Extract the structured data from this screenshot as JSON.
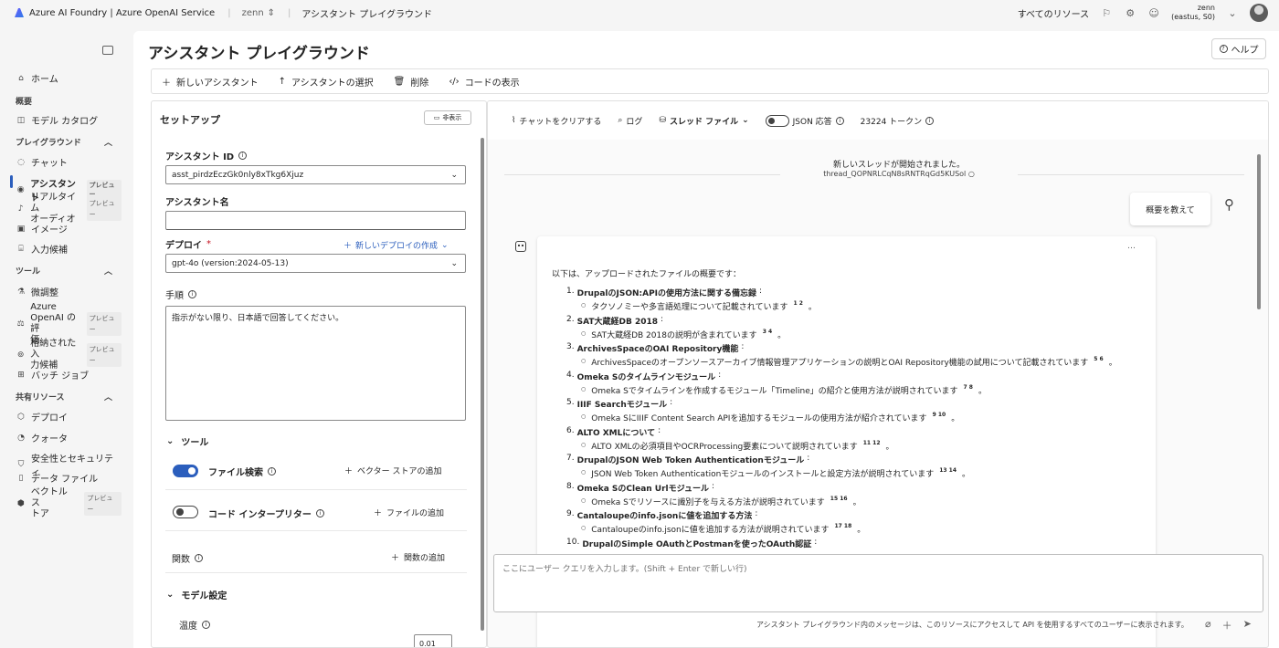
{
  "topbar": {
    "brand": "Azure AI Foundry | Azure OpenAI Service",
    "project": "zenn",
    "page": "アシスタント プレイグラウンド",
    "all_resources": "すべてのリソース",
    "user_name": "zenn",
    "user_region": "(eastus, S0)"
  },
  "sidebar": {
    "home": "ホーム",
    "overview_section": "概要",
    "model_catalog": "モデル カタログ",
    "playground_section": "プレイグラウンド",
    "chat": "チャット",
    "assistant": "アシスタント",
    "assistant_badge": "プレビュー",
    "realtime": "リアルタイム",
    "realtime2": "オーディオ",
    "realtime_badge": "プレビュー",
    "image": "イメージ",
    "completions": "入力候補",
    "tools_section": "ツール",
    "finetune": "微調整",
    "eval_1": "Azure",
    "eval_2": "OpenAI の評",
    "eval_3": "価",
    "eval_badge": "プレビュー",
    "stored_1": "格納された入",
    "stored_2": "力候補",
    "stored_badge": "プレビュー",
    "batch": "バッチ ジョブ",
    "shared_section": "共有リソース",
    "deploy": "デプロイ",
    "quota": "クォータ",
    "safety": "安全性とセキュリティ",
    "data_files": "データ ファイル",
    "vector_1": "ベクトル ス",
    "vector_2": "トア",
    "vector_badge": "プレビュー"
  },
  "main": {
    "title": "アシスタント プレイグラウンド",
    "help": "ヘルプ"
  },
  "toolbar": {
    "new_assistant": "新しいアシスタント",
    "select_assistant": "アシスタントの選択",
    "delete": "削除",
    "view_code": "コードの表示"
  },
  "setup": {
    "title": "セットアップ",
    "hide": "非表示",
    "assistant_id_label": "アシスタント ID",
    "assistant_id_value": "asst_pirdzEczGk0nly8xTkg6Xjuz",
    "assistant_name_label": "アシスタント名",
    "deploy_label": "デプロイ",
    "deploy_required": "*",
    "create_deploy": "新しいデプロイの作成",
    "deploy_value": "gpt-4o (version:2024-05-13)",
    "instructions_label": "手順",
    "instructions_value": "指示がない限り、日本語で回答してください。",
    "tools_head": "ツール",
    "file_search": "ファイル検索",
    "add_vector_store": "ベクター ストアの追加",
    "code_interpreter": "コード インタープリター",
    "add_file": "ファイルの追加",
    "functions": "関数",
    "add_function": "関数の追加",
    "model_settings": "モデル設定",
    "temperature": "温度",
    "temperature_value": "0.01"
  },
  "chat": {
    "clear": "チャットをクリアする",
    "log": "ログ",
    "thread_files": "スレッド ファイル",
    "json_mode": "JSON 応答",
    "tokens": "23224 トークン",
    "thread_started": "新しいスレッドが開始されました。",
    "thread_id": "thread_QOPNRLCqN8sRNTRqGd5KUSol",
    "user_message": "概要を教えて",
    "more": "…",
    "intro": "以下は、アップロードされたファイルの概要です：",
    "items": [
      {
        "num": "1.",
        "title": "DrupalのJSON:APIの使用方法に関する備忘録",
        "sub": "タクソノミーや多言語処理について記載されています",
        "cite": "1 2"
      },
      {
        "num": "2.",
        "title": "SAT大蔵経DB 2018",
        "sub": "SAT大蔵経DB 2018の説明が含まれています",
        "cite": "3 4"
      },
      {
        "num": "3.",
        "title": "ArchivesSpaceのOAI Repository機能",
        "sub": "ArchivesSpaceのオープンソースアーカイブ情報管理アプリケーションの説明とOAI Repository機能の試用について記載されています",
        "cite": "5 6"
      },
      {
        "num": "4.",
        "title": "Omeka Sのタイムラインモジュール",
        "sub": "Omeka Sでタイムラインを作成するモジュール「Timeline」の紹介と使用方法が説明されています",
        "cite": "7 8"
      },
      {
        "num": "5.",
        "title": "IIIF Searchモジュール",
        "sub": "Omeka SにIIIF Content Search APIを追加するモジュールの使用方法が紹介されています",
        "cite": "9 10"
      },
      {
        "num": "6.",
        "title": "ALTO XMLについて",
        "sub": "ALTO XMLの必須項目やOCRProcessing要素について説明されています",
        "cite": "11 12"
      },
      {
        "num": "7.",
        "title": "DrupalのJSON Web Token Authenticationモジュール",
        "sub": "JSON Web Token Authenticationモジュールのインストールと設定方法が説明されています",
        "cite": "13 14"
      },
      {
        "num": "8.",
        "title": "Omeka SのClean Urlモジュール",
        "sub": "Omeka Sでリソースに識別子を与える方法が説明されています",
        "cite": "15 16"
      },
      {
        "num": "9.",
        "title": "Cantaloupeのinfo.jsonに値を追加する方法",
        "sub": "Cantaloupeのinfo.jsonに値を追加する方法が説明されています",
        "cite": "17 18"
      },
      {
        "num": "10.",
        "title": "DrupalのSimple OAuthとPostmanを使ったOAuth認証",
        "sub": "",
        "cite": ""
      }
    ],
    "input_placeholder": "ここにユーザー クエリを入力します。(Shift + Enter で新しい行)",
    "footer": "アシスタント プレイグラウンド内のメッセージは、このリソースにアクセスして API を使用するすべてのユーザーに表示されます。"
  }
}
